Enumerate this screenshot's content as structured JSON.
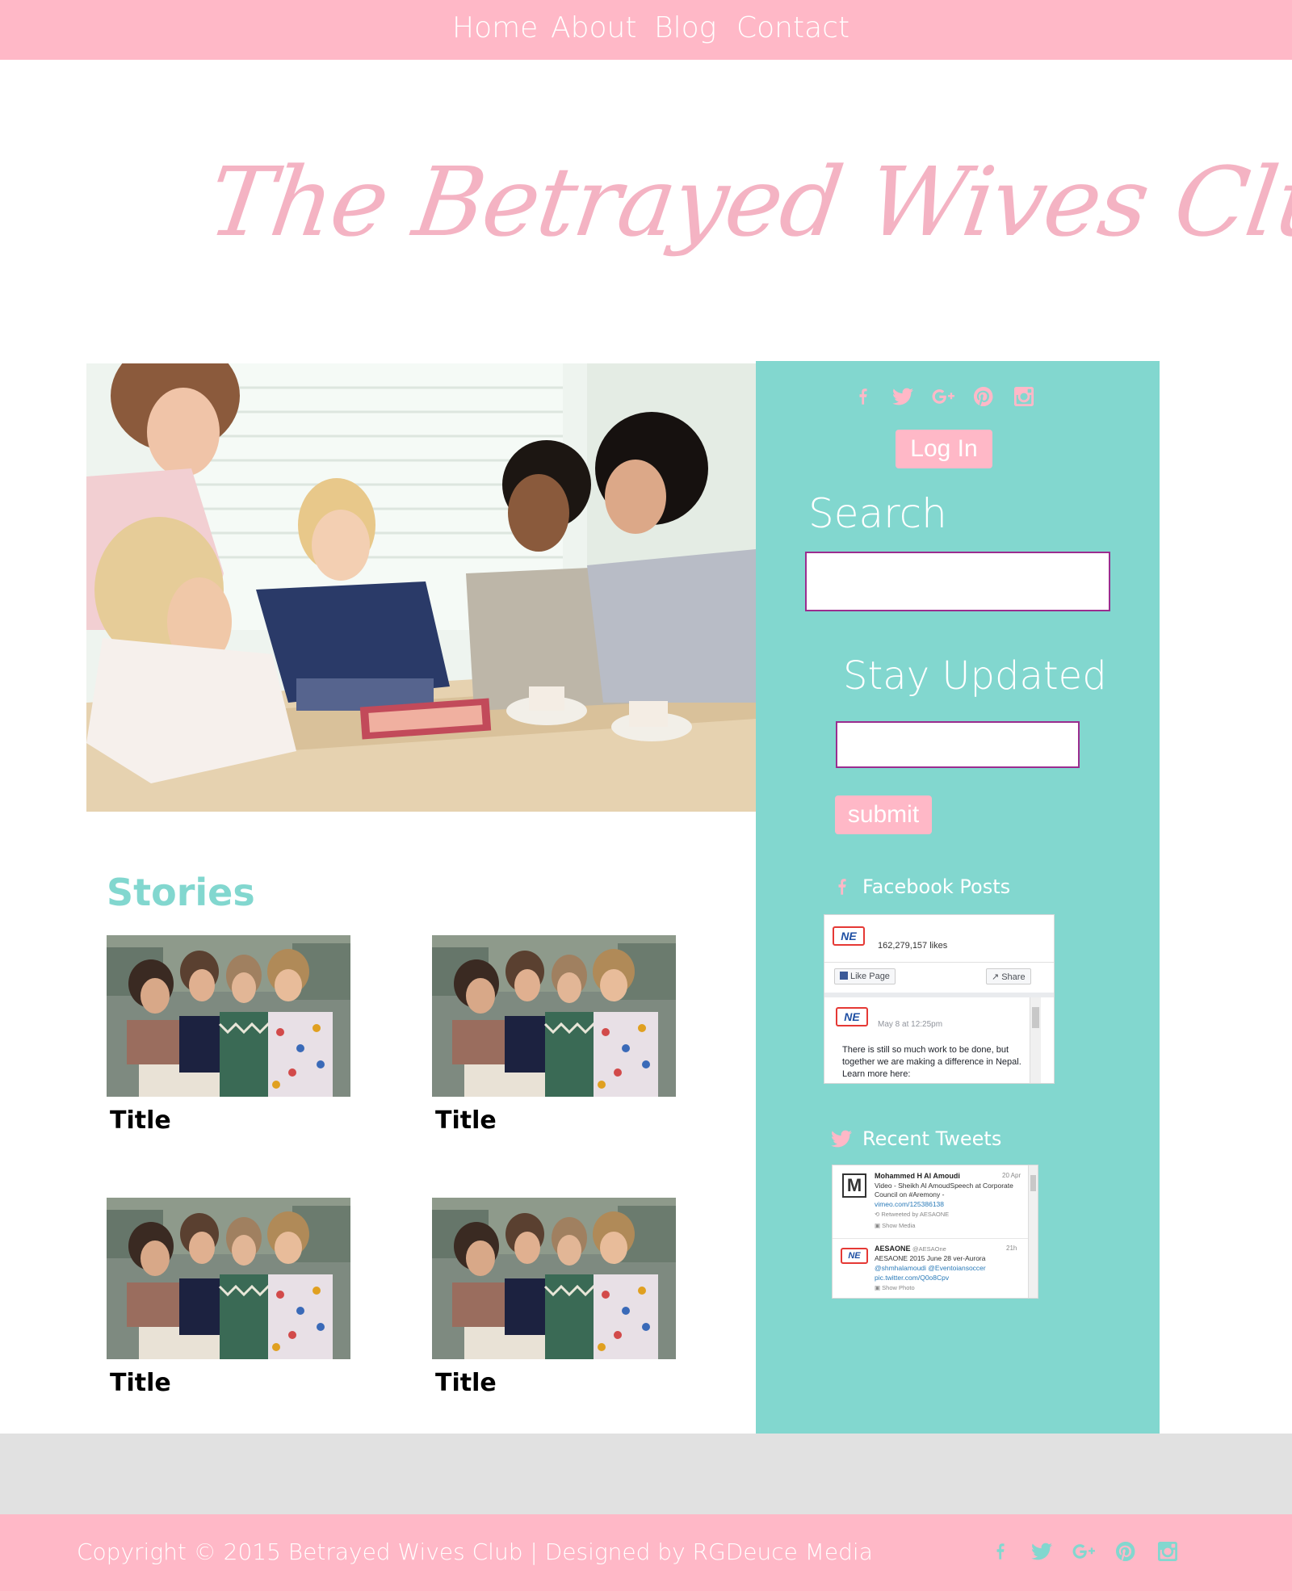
{
  "nav": {
    "items": [
      {
        "label": "Home"
      },
      {
        "label": "About"
      },
      {
        "label": "Blog"
      },
      {
        "label": "Contact"
      }
    ]
  },
  "site": {
    "title": "The Betrayed Wives Club"
  },
  "colors": {
    "pink": "#ffb8c7",
    "logo_pink": "#f4b3c3",
    "teal": "#82d7cf",
    "grey_band": "#e1e1e1",
    "input_border": "#9b2d8f"
  },
  "sidebar": {
    "social_icons": [
      "facebook-icon",
      "twitter-icon",
      "google-plus-icon",
      "pinterest-icon",
      "instagram-icon"
    ],
    "login_label": "Log In",
    "search_heading": "Search",
    "search_value": "",
    "stay_updated_heading": "Stay Updated",
    "email_value": "",
    "submit_label": "submit",
    "facebook_heading": "Facebook Posts",
    "tweets_heading": "Recent Tweets"
  },
  "fb_widget": {
    "logo_text": "NE",
    "likes": "162,279,157 likes",
    "like_button": "Like Page",
    "share_button": "Share",
    "post_date": "May 8 at 12:25pm",
    "post_text": "There is still so much work to be done, but together we are making a difference in Nepal. Learn more here:"
  },
  "tw_widget": {
    "tweet1": {
      "avatar_letter": "M",
      "name": "Mohammed H Al Amoudi",
      "date": "20 Apr",
      "text": "Video - Sheikh Al AmoudSpeech at Corporate Council on #Aremony -",
      "link": "vimeo.com/125386138",
      "retweet": "Retweeted by AESAONE",
      "media": "Show Media"
    },
    "tweet2": {
      "name": "AESAONE",
      "handle": "@AESAOne",
      "date": "21h",
      "text": "AESAONE 2015 June 28 ver-Aurora",
      "mentions": "@shmhalamoudi @Eventoiansoccer",
      "link": "pic.twitter.com/Q0o8Cpv",
      "media": "Show Photo"
    }
  },
  "stories": {
    "heading": "Stories",
    "items": [
      {
        "title": "Title"
      },
      {
        "title": "Title"
      },
      {
        "title": "Title"
      },
      {
        "title": "Title"
      }
    ]
  },
  "footer": {
    "copyright": "Copyright © 2015 Betrayed Wives Club | Designed by RGDeuce Media",
    "social_icons": [
      "facebook-icon",
      "twitter-icon",
      "google-plus-icon",
      "pinterest-icon",
      "instagram-icon"
    ]
  }
}
